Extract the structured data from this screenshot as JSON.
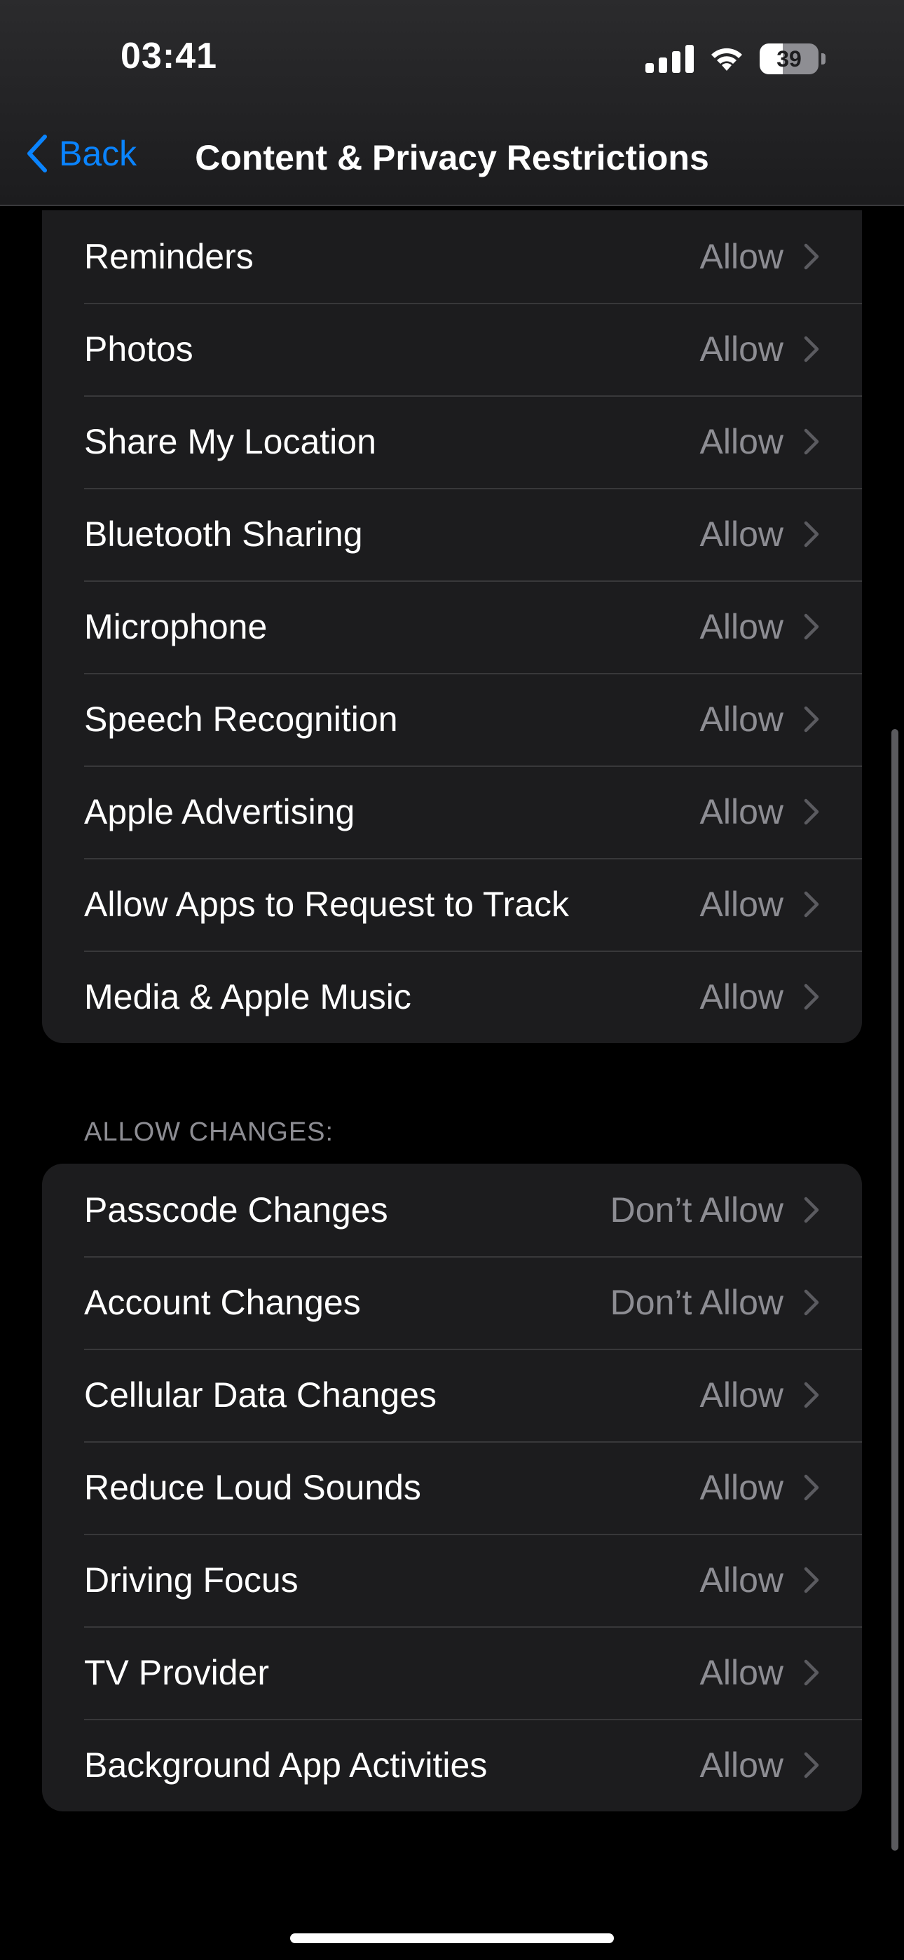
{
  "status_bar": {
    "time": "03:41",
    "battery": "39"
  },
  "nav": {
    "back_label": "Back",
    "title": "Content & Privacy Restrictions"
  },
  "privacy_rows": [
    {
      "label": "Reminders",
      "value": "Allow"
    },
    {
      "label": "Photos",
      "value": "Allow"
    },
    {
      "label": "Share My Location",
      "value": "Allow"
    },
    {
      "label": "Bluetooth Sharing",
      "value": "Allow"
    },
    {
      "label": "Microphone",
      "value": "Allow"
    },
    {
      "label": "Speech Recognition",
      "value": "Allow"
    },
    {
      "label": "Apple Advertising",
      "value": "Allow"
    },
    {
      "label": "Allow Apps to Request to Track",
      "value": "Allow"
    },
    {
      "label": "Media & Apple Music",
      "value": "Allow"
    }
  ],
  "allow_changes": {
    "header": "ALLOW CHANGES:",
    "rows": [
      {
        "label": "Passcode Changes",
        "value": "Don’t Allow"
      },
      {
        "label": "Account Changes",
        "value": "Don’t Allow"
      },
      {
        "label": "Cellular Data Changes",
        "value": "Allow"
      },
      {
        "label": "Reduce Loud Sounds",
        "value": "Allow"
      },
      {
        "label": "Driving Focus",
        "value": "Allow"
      },
      {
        "label": "TV Provider",
        "value": "Allow"
      },
      {
        "label": "Background App Activities",
        "value": "Allow"
      }
    ]
  },
  "colors": {
    "accent": "#0a84ff",
    "secondary_text": "#8d8d93",
    "cell_bg": "#1c1c1e"
  },
  "icons": {
    "back": "chevron-left-icon",
    "disclosure": "chevron-right-icon",
    "signal": "cellular-signal-icon",
    "wifi": "wifi-icon",
    "battery": "battery-icon"
  }
}
